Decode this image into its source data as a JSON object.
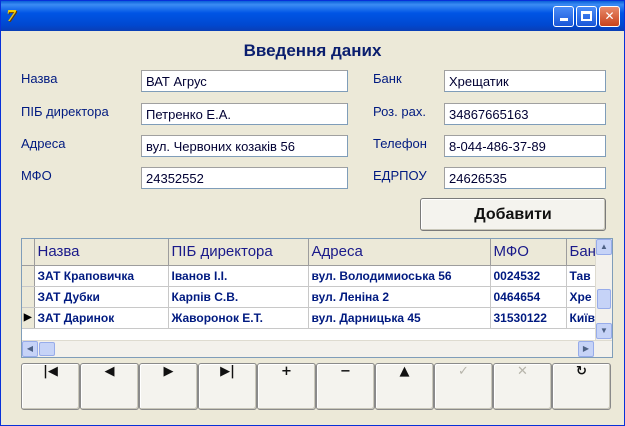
{
  "window": {
    "app_icon": "7",
    "buttons": {
      "min": "minimize-icon",
      "max": "maximize-icon",
      "close": "✕"
    }
  },
  "form": {
    "title": "Введення даних",
    "fields": {
      "name": {
        "label": "Назва",
        "value": "ВАТ Агрус"
      },
      "director": {
        "label": "ПІБ директора",
        "value": "Петренко Е.А."
      },
      "address": {
        "label": "Адреса",
        "value": "вул. Червоних козаків 56"
      },
      "mfo": {
        "label": "МФО",
        "value": "24352552"
      },
      "bank": {
        "label": "Банк",
        "value": "Хрещатик"
      },
      "account": {
        "label": "Роз. рах.",
        "value": "34867665163"
      },
      "phone": {
        "label": "Телефон",
        "value": "8-044-486-37-89"
      },
      "edrpou": {
        "label": "ЕДРПОУ",
        "value": "24626535"
      }
    },
    "add_button": "Добавити"
  },
  "grid": {
    "columns": [
      "Назва",
      "ПІБ директора",
      "Адреса",
      "МФО",
      "Банк"
    ],
    "rows": [
      [
        "ЗАТ Краповичка",
        "Іванов І.І.",
        "вул. Володимиоська 56",
        "0024532",
        "Тав"
      ],
      [
        "ЗАТ Дубки",
        "Карпів С.В.",
        "вул. Леніна 2",
        "0464654",
        "Хре"
      ],
      [
        "ЗАТ Даринок",
        "Жаворонок Е.Т.",
        "вул. Дарницька 45",
        "31530122",
        "Київ"
      ]
    ],
    "current_row_indicator": "▶"
  },
  "navigator": {
    "buttons": [
      {
        "name": "first-record",
        "icon": "|◀",
        "enabled": true
      },
      {
        "name": "prior-record",
        "icon": "◀",
        "enabled": true
      },
      {
        "name": "next-record",
        "icon": "▶",
        "enabled": true
      },
      {
        "name": "last-record",
        "icon": "▶|",
        "enabled": true
      },
      {
        "name": "insert-record",
        "icon": "+",
        "enabled": true
      },
      {
        "name": "delete-record",
        "icon": "−",
        "enabled": true
      },
      {
        "name": "edit-record",
        "icon": "▲",
        "enabled": true
      },
      {
        "name": "post-record",
        "icon": "✓",
        "enabled": false
      },
      {
        "name": "cancel-record",
        "icon": "✕",
        "enabled": false
      },
      {
        "name": "refresh-records",
        "icon": "↻",
        "enabled": true
      }
    ]
  }
}
